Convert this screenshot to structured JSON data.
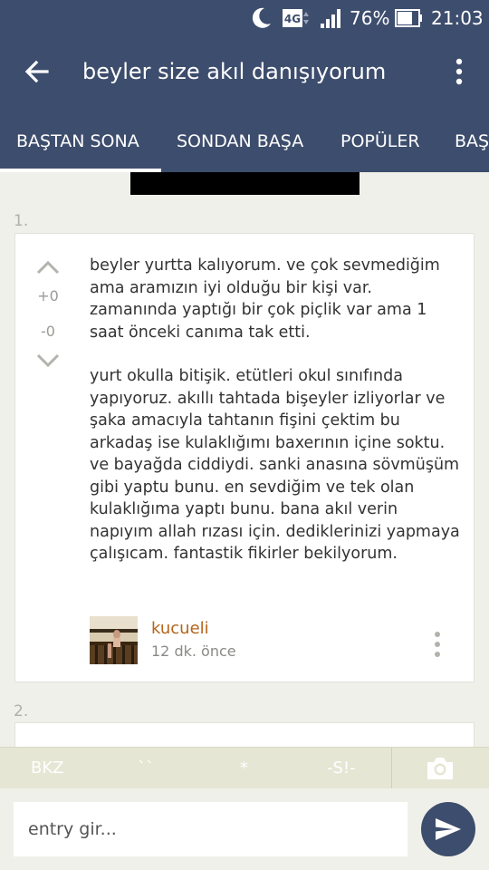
{
  "status_bar": {
    "network": "4G",
    "battery": "76%",
    "time": "21:03",
    "icons": [
      "moon-icon",
      "network-4g-icon",
      "signal-icon",
      "battery-icon"
    ]
  },
  "toolbar": {
    "title": "beyler size akıl danışıyorum",
    "back_icon": "arrow-left-icon",
    "more_icon": "more-vertical-icon"
  },
  "tabs": [
    {
      "label": "BAŞTAN SONA",
      "active": true
    },
    {
      "label": "SONDAN BAŞA",
      "active": false
    },
    {
      "label": "POPÜLER",
      "active": false
    },
    {
      "label": "BAŞ",
      "active": false
    }
  ],
  "entries": [
    {
      "number": "1.",
      "up_votes": "+0",
      "down_votes": "-0",
      "paragraphs": [
        "beyler yurtta kalıyorum. ve çok sevmediğim ama aramızın iyi olduğu bir kişi var. zamanında yaptığı bir çok piçlik var ama 1 saat önceki canıma tak etti.",
        "yurt okulla bitişik. etütleri okul sınıfında yapıyoruz. akıllı tahtada bişeyler izliyorlar ve şaka amacıyla tahtanın fişini çektim bu arkadaş ise kulaklığımı baxerının içine soktu. ve bayağda ciddiydi. sanki anasına sövmüşüm gibi yaptu bunu. en sevdiğim ve tek olan kulaklığıma yaptı bunu. bana akıl verin napıyım allah rızası için. dediklerinizi yapmaya çalışıcam. fantastik fikirler bekilyorum."
      ],
      "author": "kucueli",
      "time": "12 dk. önce"
    },
    {
      "number": "2."
    }
  ],
  "shortcuts": [
    "BKZ",
    "``",
    "*",
    "-S!-"
  ],
  "camera_icon": "camera-icon",
  "input": {
    "placeholder": "entry gir..."
  },
  "send_icon": "send-icon",
  "colors": {
    "primary": "#3d4d6d",
    "background": "#f0f0ea",
    "author": "#b5641a"
  }
}
